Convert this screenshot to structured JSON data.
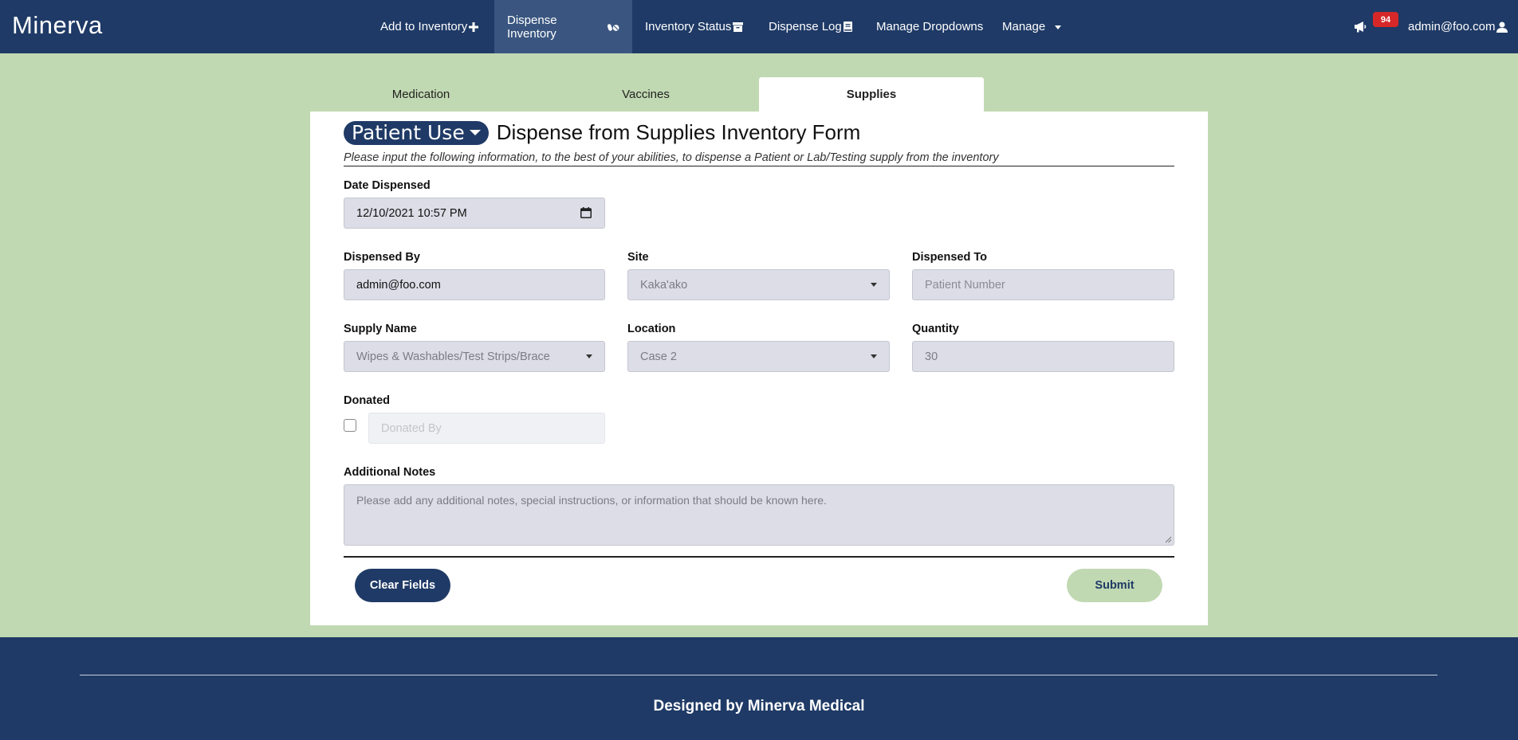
{
  "app": {
    "brand": "Minerva"
  },
  "nav": {
    "add_inventory": "Add to Inventory",
    "dispense_inventory": "Dispense Inventory",
    "inventory_status": "Inventory Status",
    "dispense_log": "Dispense Log",
    "manage_dropdowns": "Manage Dropdowns",
    "manage": "Manage",
    "notification_count": "94",
    "user_email": "admin@foo.com"
  },
  "tabs": [
    {
      "label": "Medication",
      "active": false
    },
    {
      "label": "Vaccines",
      "active": false
    },
    {
      "label": "Supplies",
      "active": true
    }
  ],
  "form": {
    "type_selector": "Patient Use",
    "title": "Dispense from Supplies Inventory Form",
    "subtitle": "Please input the following information, to the best of your abilities, to dispense a Patient or Lab/Testing supply from the inventory",
    "date_dispensed": {
      "label": "Date Dispensed",
      "value": "12/10/2021 10:57 PM"
    },
    "dispensed_by": {
      "label": "Dispensed By",
      "value": "admin@foo.com"
    },
    "site": {
      "label": "Site",
      "value": "Kaka'ako"
    },
    "dispensed_to": {
      "label": "Dispensed To",
      "placeholder": "Patient Number"
    },
    "supply_name": {
      "label": "Supply Name",
      "value": "Wipes & Washables/Test Strips/Brace"
    },
    "location": {
      "label": "Location",
      "value": "Case 2"
    },
    "quantity": {
      "label": "Quantity",
      "value": "30"
    },
    "donated": {
      "label": "Donated",
      "checked": false,
      "donated_by_placeholder": "Donated By"
    },
    "additional_notes": {
      "label": "Additional Notes",
      "placeholder": "Please add any additional notes, special instructions, or information that should be known here."
    },
    "clear_button": "Clear Fields",
    "submit_button": "Submit"
  },
  "footer": {
    "text": "Designed by Minerva Medical"
  },
  "colors": {
    "navy": "#1f3a66",
    "sage": "#c1d9b2",
    "badge_red": "#d62828",
    "field_bg": "#dcdde6"
  }
}
